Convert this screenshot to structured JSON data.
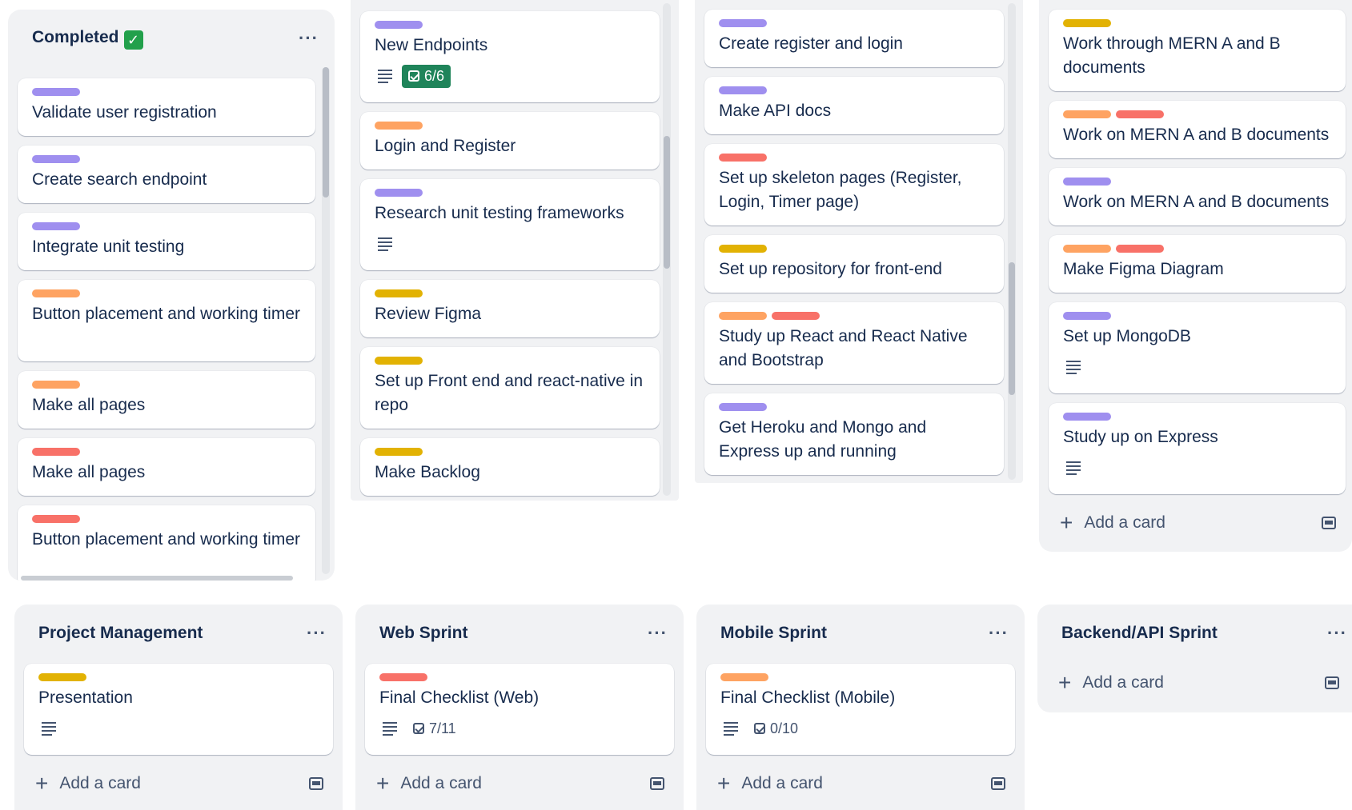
{
  "colors": {
    "purple": "#9f8fef",
    "orange": "#fea362",
    "red": "#f87168",
    "yellow": "#e2b203",
    "green": "#1f845a"
  },
  "lists": {
    "completed": {
      "title": "Completed",
      "title_emoji": "✓",
      "cards": [
        {
          "title": "Validate user registration"
        },
        {
          "title": "Create search endpoint"
        },
        {
          "title": "Integrate unit testing"
        },
        {
          "title": "Button placement and working timer"
        },
        {
          "title": "Make all pages"
        },
        {
          "title": "Make all pages"
        },
        {
          "title": "Button placement and working timer"
        }
      ]
    },
    "col2": {
      "cards": [
        {
          "title": "New Endpoints",
          "checklist": "6/6"
        },
        {
          "title": "Login and Register"
        },
        {
          "title": "Research unit testing frameworks"
        },
        {
          "title": "Review Figma"
        },
        {
          "title": "Set up Front end and react-native in repo"
        },
        {
          "title": "Make Backlog"
        }
      ]
    },
    "col3": {
      "cards": [
        {
          "title": "Create register and login"
        },
        {
          "title": "Make API docs"
        },
        {
          "title": "Set up skeleton pages (Register, Login, Timer page)"
        },
        {
          "title": "Set up repository for front-end"
        },
        {
          "title": "Study up React and React Native and Bootstrap"
        },
        {
          "title": "Get Heroku and Mongo and Express up and running"
        }
      ]
    },
    "col4": {
      "cards": [
        {
          "title": "Work through MERN A and B documents"
        },
        {
          "title": "Work on MERN A and B documents"
        },
        {
          "title": "Work on MERN A and B documents"
        },
        {
          "title": "Make Figma Diagram"
        },
        {
          "title": "Set up MongoDB"
        },
        {
          "title": "Study up on Express"
        }
      ],
      "add_card": "Add a card"
    },
    "project_management": {
      "title": "Project Management",
      "cards": [
        {
          "title": "Presentation"
        }
      ],
      "add_card": "Add a card"
    },
    "web_sprint": {
      "title": "Web Sprint",
      "cards": [
        {
          "title": "Final Checklist (Web)",
          "checklist": "7/11"
        }
      ],
      "add_card": "Add a card"
    },
    "mobile_sprint": {
      "title": "Mobile Sprint",
      "cards": [
        {
          "title": "Final Checklist (Mobile)",
          "checklist": "0/10"
        }
      ],
      "add_card": "Add a card"
    },
    "backend_sprint": {
      "title": "Backend/API Sprint",
      "add_card": "Add a card"
    }
  },
  "menu_label": "···"
}
